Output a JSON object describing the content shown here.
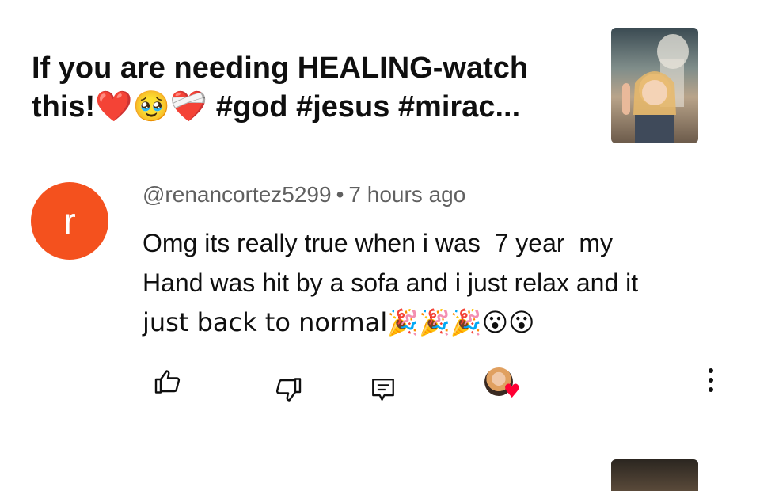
{
  "video": {
    "title_line1": "If you are needing HEALING-watch",
    "title_line2_prefix": "this!",
    "title_emojis": "❤️🥹❤️‍🩹",
    "title_line2_suffix": " #god #jesus #mirac...",
    "thumbnail_icon": "video-thumbnail"
  },
  "comment": {
    "avatar_letter": "r",
    "avatar_color": "#f4511e",
    "author": "@renancortez5299",
    "separator": "•",
    "time": "7 hours ago",
    "text_line1": "Omg its really true when i was  7 year  my",
    "text_line2": "Hand was hit by a sofa and i just relax and it",
    "text_line3": "just back to normal🎉🎉🎉😮😮"
  },
  "actions": {
    "like_icon": "thumbs-up-icon",
    "dislike_icon": "thumbs-down-icon",
    "reply_icon": "reply-icon",
    "creator_heart_icon": "creator-heart-icon",
    "more_icon": "more-vertical-icon",
    "heart_color": "#ff0033"
  }
}
